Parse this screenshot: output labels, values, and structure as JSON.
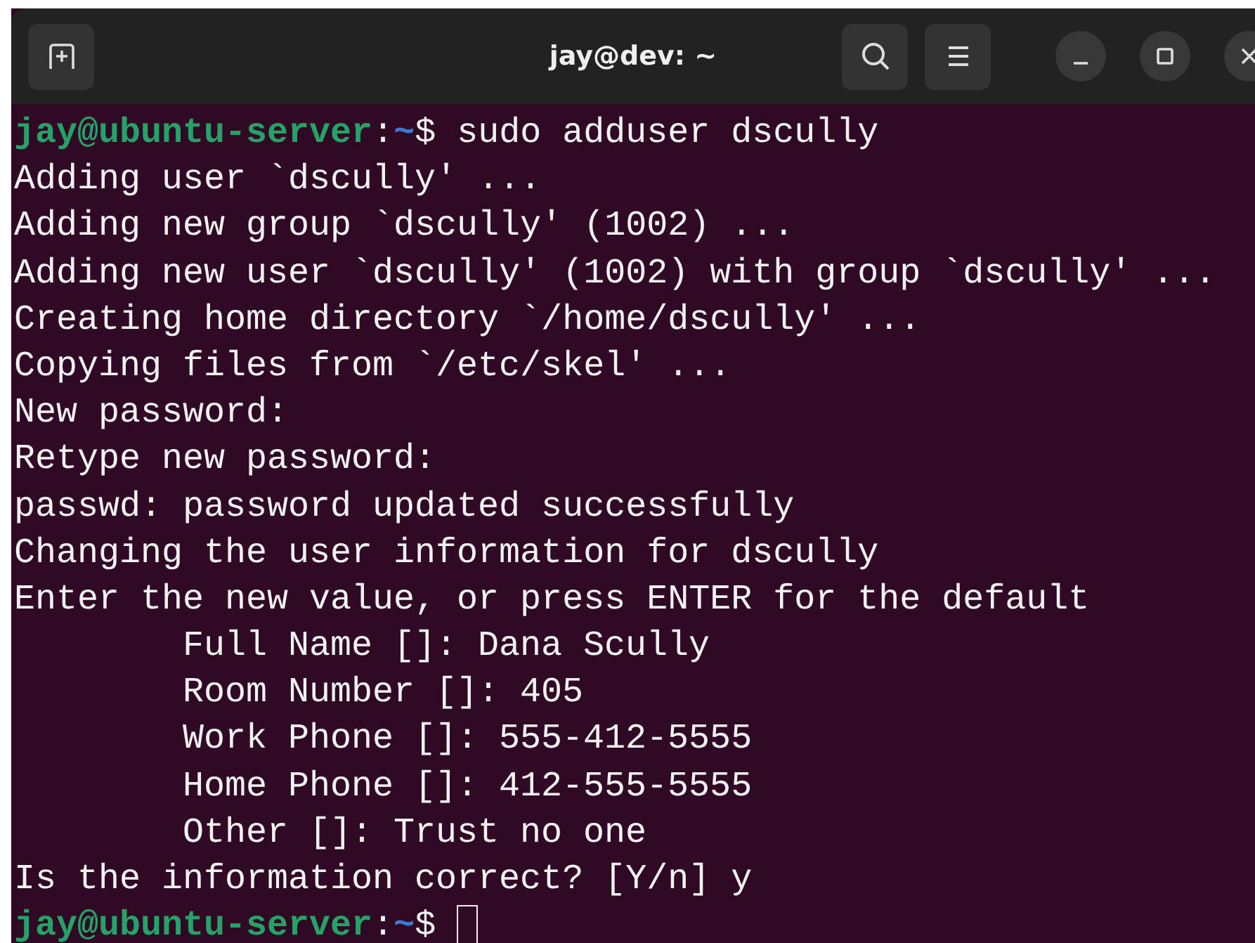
{
  "window": {
    "title": "jay@dev: ~"
  },
  "terminal": {
    "lines": [
      {
        "kind": "prompt",
        "user_host": "jay@ubuntu-server",
        "separator": ":",
        "path": "~",
        "symbol": "$",
        "command": "sudo adduser dscully"
      },
      {
        "kind": "output",
        "text": "Adding user `dscully' ..."
      },
      {
        "kind": "output",
        "text": "Adding new group `dscully' (1002) ..."
      },
      {
        "kind": "output",
        "text": "Adding new user `dscully' (1002) with group `dscully' ..."
      },
      {
        "kind": "output",
        "text": "Creating home directory `/home/dscully' ..."
      },
      {
        "kind": "output",
        "text": "Copying files from `/etc/skel' ..."
      },
      {
        "kind": "output",
        "text": "New password:"
      },
      {
        "kind": "output",
        "text": "Retype new password:"
      },
      {
        "kind": "output",
        "text": "passwd: password updated successfully"
      },
      {
        "kind": "output",
        "text": "Changing the user information for dscully"
      },
      {
        "kind": "output",
        "text": "Enter the new value, or press ENTER for the default"
      },
      {
        "kind": "field",
        "text": "Full Name []: Dana Scully"
      },
      {
        "kind": "field",
        "text": "Room Number []: 405"
      },
      {
        "kind": "field",
        "text": "Work Phone []: 555-412-5555"
      },
      {
        "kind": "field",
        "text": "Home Phone []: 412-555-5555"
      },
      {
        "kind": "field",
        "text": "Other []: Trust no one"
      },
      {
        "kind": "output",
        "text": "Is the information correct? [Y/n] y"
      },
      {
        "kind": "prompt",
        "user_host": "jay@ubuntu-server",
        "separator": ":",
        "path": "~",
        "symbol": "$",
        "cursor": true
      }
    ]
  }
}
